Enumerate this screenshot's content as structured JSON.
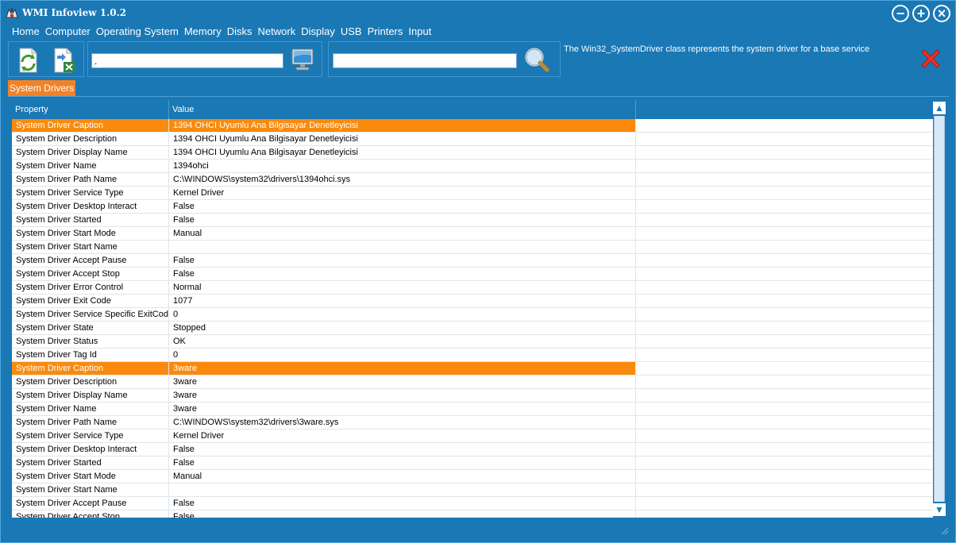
{
  "window": {
    "title": "WMI Infoview 1.0.2"
  },
  "window_controls": {
    "minimize": "−",
    "maximize": "+",
    "close": "×"
  },
  "menu": [
    "Home",
    "Computer",
    "Operating System",
    "Memory",
    "Disks",
    "Network",
    "Display",
    "USB",
    "Printers",
    "Input"
  ],
  "toolbar": {
    "computer_value": ".",
    "search_value": "",
    "description": "The Win32_SystemDriver class represents the system driver for a base service"
  },
  "tabs": [
    {
      "label": "System Drivers"
    }
  ],
  "grid": {
    "columns": [
      "Property",
      "Value"
    ],
    "rows": [
      {
        "property": "System Driver Caption",
        "value": "1394 OHCI Uyumlu Ana Bilgisayar Denetleyicisi",
        "selected": true
      },
      {
        "property": "System Driver Description",
        "value": "1394 OHCI Uyumlu Ana Bilgisayar Denetleyicisi"
      },
      {
        "property": "System Driver Display Name",
        "value": "1394 OHCI Uyumlu Ana Bilgisayar Denetleyicisi"
      },
      {
        "property": "System Driver Name",
        "value": "1394ohci"
      },
      {
        "property": "System Driver Path Name",
        "value": "C:\\WINDOWS\\system32\\drivers\\1394ohci.sys"
      },
      {
        "property": "System Driver Service Type",
        "value": "Kernel Driver"
      },
      {
        "property": "System Driver Desktop Interact",
        "value": "False"
      },
      {
        "property": "System Driver Started",
        "value": "False"
      },
      {
        "property": "System Driver Start Mode",
        "value": "Manual"
      },
      {
        "property": "System Driver Start Name",
        "value": ""
      },
      {
        "property": "System Driver Accept Pause",
        "value": "False"
      },
      {
        "property": "System Driver Accept Stop",
        "value": "False"
      },
      {
        "property": "System Driver Error Control",
        "value": "Normal"
      },
      {
        "property": "System Driver Exit Code",
        "value": "1077"
      },
      {
        "property": "System Driver Service Specific ExitCode",
        "value": "0"
      },
      {
        "property": "System Driver State",
        "value": "Stopped"
      },
      {
        "property": "System Driver Status",
        "value": "OK"
      },
      {
        "property": "System Driver Tag Id",
        "value": "0"
      },
      {
        "property": "System Driver Caption",
        "value": "3ware",
        "selected": true
      },
      {
        "property": "System Driver Description",
        "value": "3ware"
      },
      {
        "property": "System Driver Display Name",
        "value": "3ware"
      },
      {
        "property": "System Driver Name",
        "value": "3ware"
      },
      {
        "property": "System Driver Path Name",
        "value": "C:\\WINDOWS\\system32\\drivers\\3ware.sys"
      },
      {
        "property": "System Driver Service Type",
        "value": "Kernel Driver"
      },
      {
        "property": "System Driver Desktop Interact",
        "value": "False"
      },
      {
        "property": "System Driver Started",
        "value": "False"
      },
      {
        "property": "System Driver Start Mode",
        "value": "Manual"
      },
      {
        "property": "System Driver Start Name",
        "value": ""
      },
      {
        "property": "System Driver Accept Pause",
        "value": "False"
      },
      {
        "property": "System Driver Accept Stop",
        "value": "False"
      }
    ]
  },
  "scrollbar": {
    "up": "▲",
    "down": "▼"
  },
  "colors": {
    "window_bg": "#1a78b5",
    "selection": "#fb8a0c",
    "tab": "#f38227",
    "close_red": "#e8322a"
  },
  "icons": {
    "app": "app-logo-icon",
    "refresh": "refresh-icon",
    "export": "export-excel-icon",
    "monitor": "monitor-icon",
    "search": "magnifier-icon",
    "close": "red-x-icon"
  }
}
